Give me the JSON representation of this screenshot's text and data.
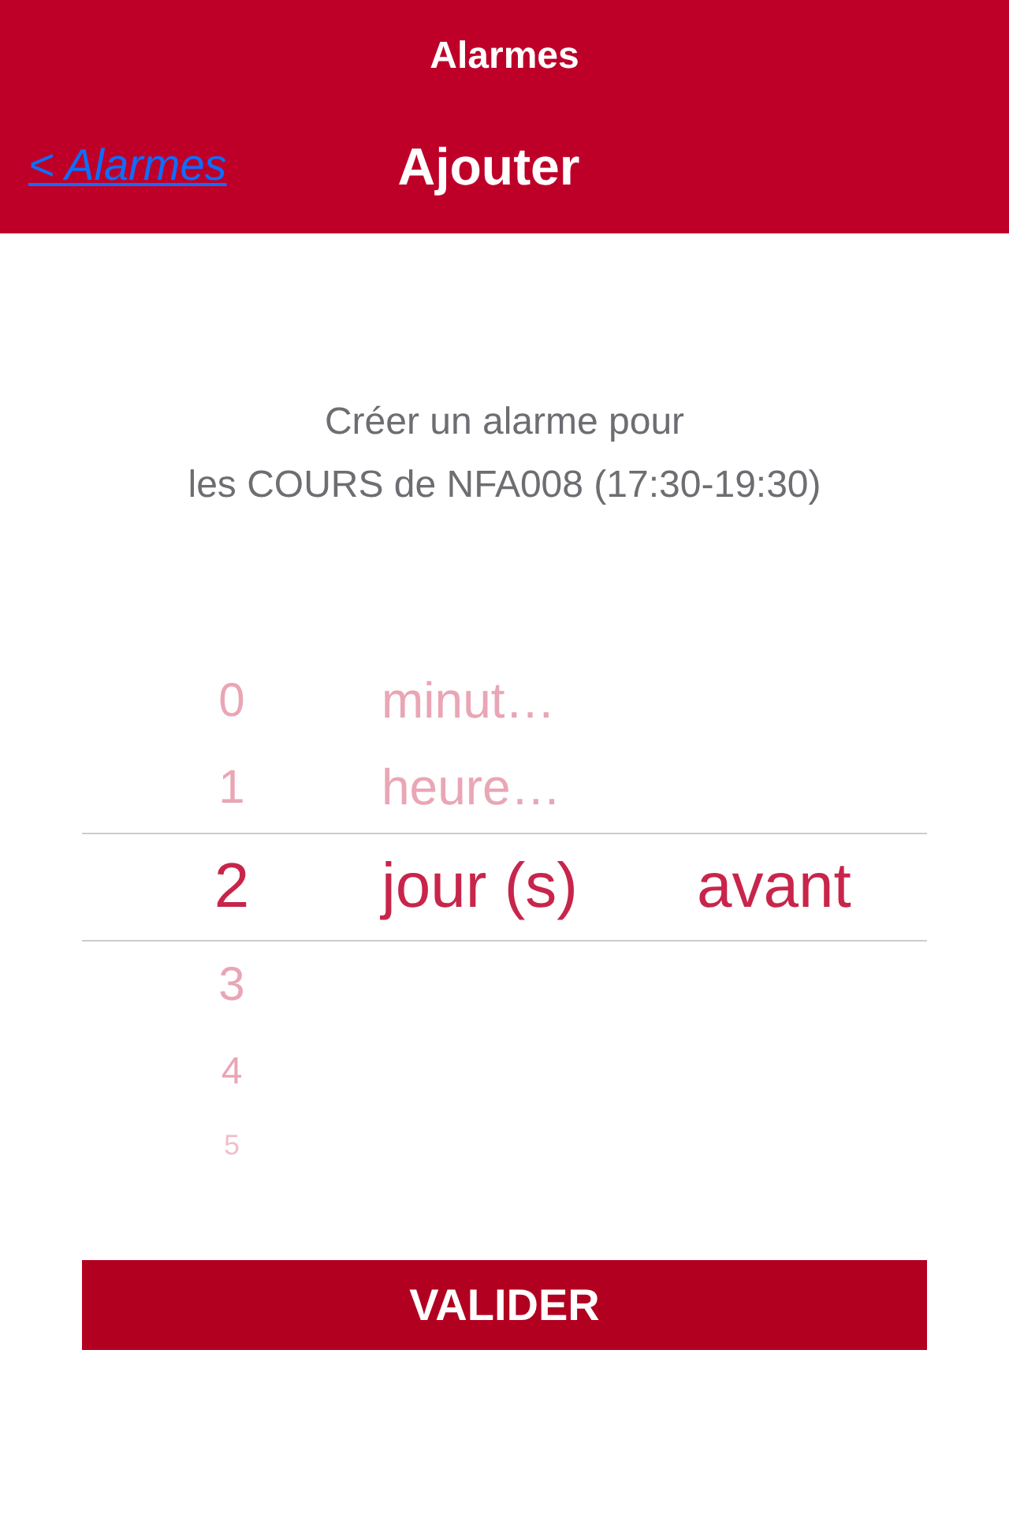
{
  "header": {
    "title": "Alarmes",
    "back": "< Alarmes",
    "subtitle": "Ajouter"
  },
  "intro": [
    "Créer un alarme pour",
    "les COURS de NFA008 (17:30-19:30)"
  ],
  "picker": {
    "columns": [
      {
        "kind": "number",
        "items": [
          {
            "label": "0",
            "selected": false
          },
          {
            "label": "1",
            "selected": false
          },
          {
            "label": "2",
            "selected": true
          },
          {
            "label": "3",
            "selected": false
          },
          {
            "label": "4",
            "selected": false
          },
          {
            "label": "5",
            "selected": false
          }
        ]
      },
      {
        "kind": "unit",
        "items": [
          {
            "label": "minut…",
            "selected": false
          },
          {
            "label": "heure…",
            "selected": false
          },
          {
            "label": "jour (s)",
            "selected": true
          }
        ]
      },
      {
        "kind": "direction",
        "items": [
          {
            "label": "avant",
            "selected": true
          }
        ]
      }
    ]
  },
  "button": "VALIDER"
}
